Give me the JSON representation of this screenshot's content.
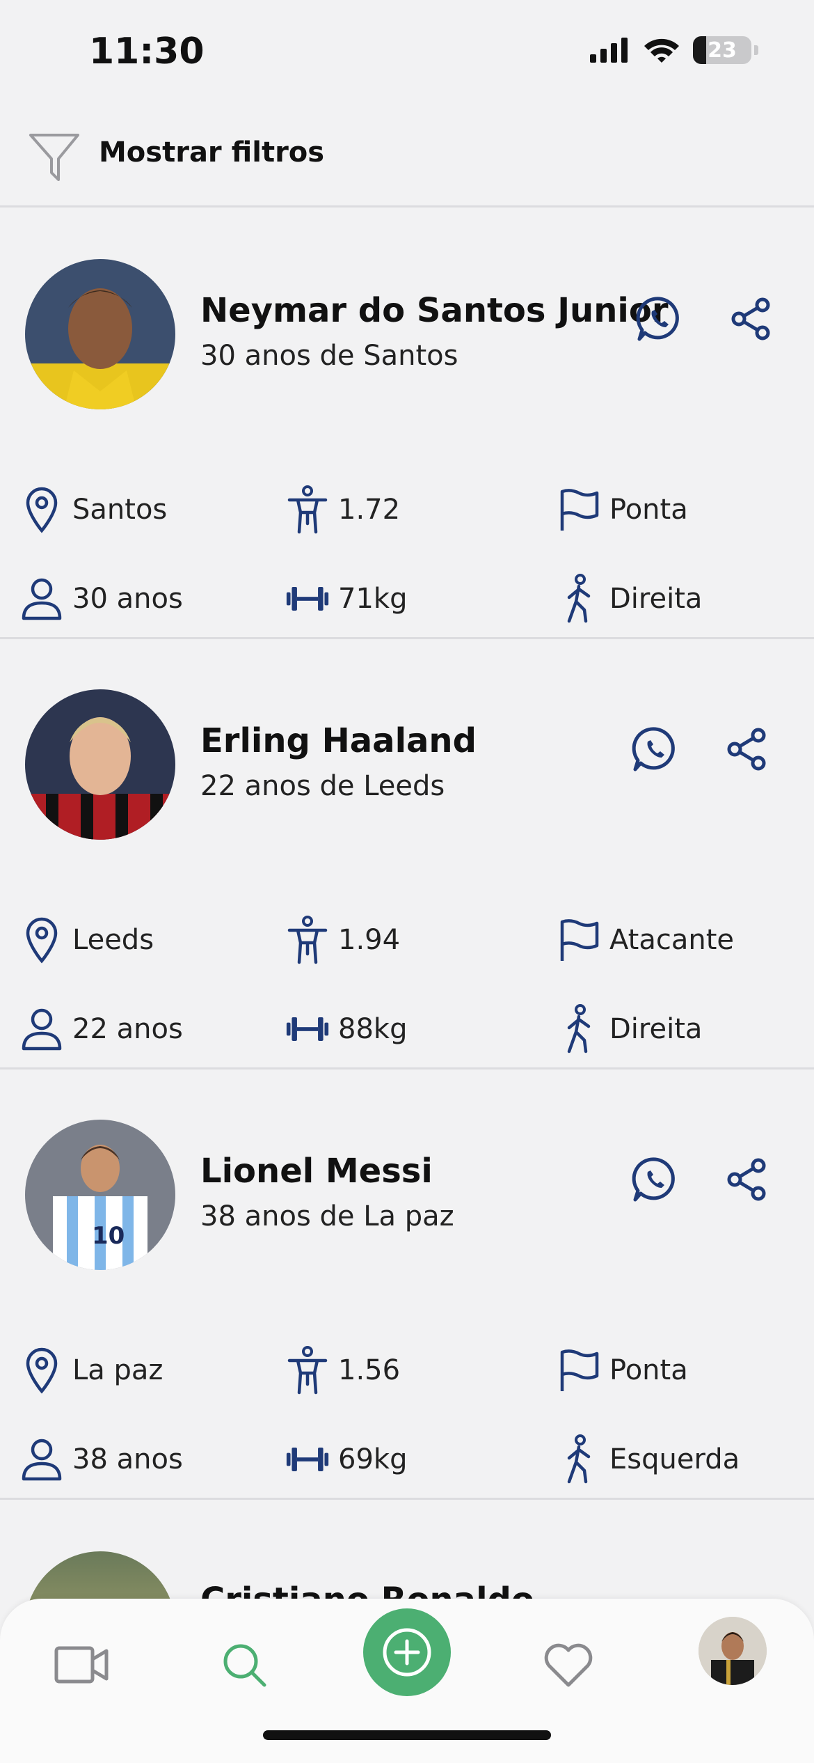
{
  "status_bar": {
    "time": "11:30",
    "battery": "23"
  },
  "filter": {
    "label": "Mostrar filtros",
    "icon": "filter-icon"
  },
  "players": [
    {
      "name": "Neymar do Santos Junior",
      "subtitle": "30 anos de Santos",
      "city": "Santos",
      "height": "1.72",
      "position": "Ponta",
      "age": "30 anos",
      "weight": "71kg",
      "foot": "Direita"
    },
    {
      "name": "Erling Haaland",
      "subtitle": "22 anos de Leeds",
      "city": "Leeds",
      "height": "1.94",
      "position": "Atacante",
      "age": "22 anos",
      "weight": "88kg",
      "foot": "Direita"
    },
    {
      "name": "Lionel Messi",
      "subtitle": "38 anos de La paz",
      "city": "La paz",
      "height": "1.56",
      "position": "Ponta",
      "age": "38 anos",
      "weight": "69kg",
      "foot": "Esquerda"
    }
  ],
  "partial_player": {
    "name": "Cristiano Ronaldo"
  },
  "tab_bar": {
    "items": [
      "video-icon",
      "search-icon",
      "add-icon",
      "heart-icon",
      "profile-avatar"
    ],
    "active": "search-icon"
  },
  "colors": {
    "accent_green": "#4caf72",
    "icon_navy": "#1f3a78",
    "background": "#f2f2f3"
  }
}
